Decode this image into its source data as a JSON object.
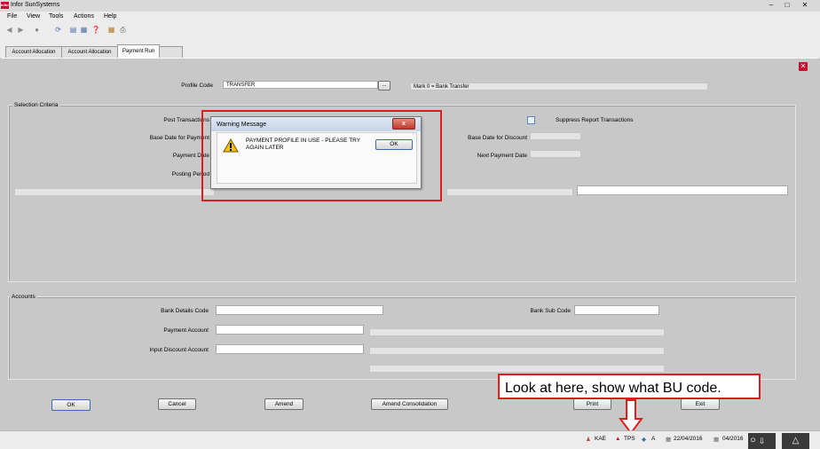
{
  "window": {
    "title": "Infor SunSystems",
    "logo_text": "infor"
  },
  "menu": [
    "File",
    "View",
    "Tools",
    "Actions",
    "Help"
  ],
  "tabs": [
    "Account Allocation",
    "Account Allocation",
    "Payment Run"
  ],
  "form": {
    "profile_code_label": "Profile Code",
    "profile_code_value": "TRANSFER",
    "lookup_label": "...",
    "profile_description": "Mark 0 = Bank Transfer",
    "selection_criteria_title": "Selection Criteria",
    "post_transactions_label": "Post Transactions",
    "base_date_payment_label": "Base Date for Payment",
    "payment_date_label": "Payment Date",
    "posting_period_label": "Posting Period",
    "suppress_report_label": "Suppress Report Transactions",
    "base_date_discount_label": "Base Date for Discount",
    "next_payment_date_label": "Next Payment Date",
    "accounts_title": "Accounts",
    "bank_details_code_label": "Bank Details Code",
    "bank_sub_code_label": "Bank Sub Code",
    "payment_account_label": "Payment Account",
    "input_discount_account_label": "Input Discount Account"
  },
  "buttons": {
    "ok": "OK",
    "cancel": "Cancel",
    "amend": "Amend",
    "amend_consolidation": "Amend Consolidation",
    "print": "Print",
    "exit": "Exit"
  },
  "dialog": {
    "title": "Warning Message",
    "close": "x",
    "message_line1": "PAYMENT PROFILE IN USE - PLEASE TRY",
    "message_line2": "AGAIN LATER",
    "ok": "OK"
  },
  "annotation": {
    "text": "Look at here, show what BU code."
  },
  "statusbar": {
    "user": "KAE",
    "bu": "TPS",
    "ledger": "A",
    "date": "22/04/2016",
    "period": "04/2016",
    "extra": "O"
  },
  "colors": {
    "highlight_red": "#e01b1b",
    "infor_red": "#c8102e"
  }
}
